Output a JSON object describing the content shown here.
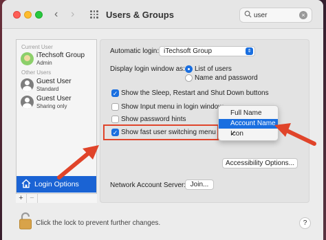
{
  "window": {
    "title": "Users & Groups",
    "nav_back": "‹",
    "nav_fwd": "›"
  },
  "search": {
    "value": "user",
    "clear": "×",
    "icon": "search-icon"
  },
  "sidebar": {
    "current_user_label": "Current User",
    "other_users_label": "Other Users",
    "users": [
      {
        "name": "iTechsoft Group",
        "role": "Admin",
        "icon": "avatar-itech"
      },
      {
        "name": "Guest User",
        "role": "Standard",
        "icon": "avatar-guest"
      },
      {
        "name": "Guest User",
        "role": "Sharing only",
        "icon": "avatar-guest"
      }
    ],
    "login_options": "Login Options",
    "plus": "+",
    "minus": "−"
  },
  "settings": {
    "automatic_login_label": "Automatic login:",
    "automatic_login_value": "iTechsoft Group",
    "display_login_label": "Display login window as:",
    "radio_list": "List of users",
    "radio_name": "Name and password",
    "cb_sleep": "Show the Sleep, Restart and Shut Down buttons",
    "cb_input": "Show Input menu in login window",
    "cb_hints": "Show password hints",
    "cb_fast": "Show fast user switching menu as",
    "check_mark": "✓",
    "accessibility_button": "Accessibility Options...",
    "network_label": "Network Account Server:",
    "join_button": "Join..."
  },
  "menu": {
    "items": [
      "Full Name",
      "Account Name",
      "Icon"
    ],
    "selected": "Account Name",
    "checked": "Icon"
  },
  "footer": {
    "lock_text": "Click the lock to prevent further changes.",
    "help": "?"
  },
  "colors": {
    "accent": "#1a63d4",
    "annotation": "#e0442a"
  }
}
